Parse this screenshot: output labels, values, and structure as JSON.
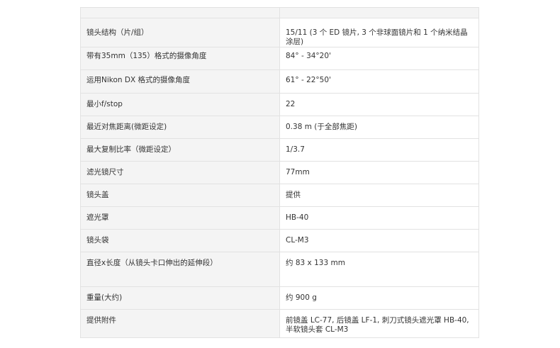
{
  "specs": [
    {
      "label": "镜头结构（片/组）",
      "value": "15/11 (3 个 ED 镜片, 3 个非球面镜片和 1 个纳米结晶涂层)"
    },
    {
      "label": "带有35mm（135）格式的摄像角度",
      "value": "84° - 34°20'"
    },
    {
      "label": "运用Nikon DX 格式的摄像角度",
      "value": "61° - 22°50'"
    },
    {
      "label": "最小f/stop",
      "value": "22"
    },
    {
      "label": "最近对焦距离(微距设定)",
      "value": "0.38 m (于全部焦距)"
    },
    {
      "label": "最大复制比率（微距设定）",
      "value": "1/3.7"
    },
    {
      "label": "滤光镜尺寸",
      "value": "77mm"
    },
    {
      "label": "镜头盖",
      "value": "提供"
    },
    {
      "label": "遮光罩",
      "value": "HB-40"
    },
    {
      "label": "镜头袋",
      "value": "CL-M3"
    },
    {
      "label": "直径x长度（从镜头卡口伸出的延伸段）",
      "value": "约 83 x 133 mm"
    },
    {
      "label": "重量(大约)",
      "value": "约 900 g"
    },
    {
      "label": "提供附件",
      "value": "前镜盖 LC-77, 后镜盖 LF-1, 刺刀式镜头遮光罩 HB-40, 半软镜头套 CL-M3"
    }
  ]
}
